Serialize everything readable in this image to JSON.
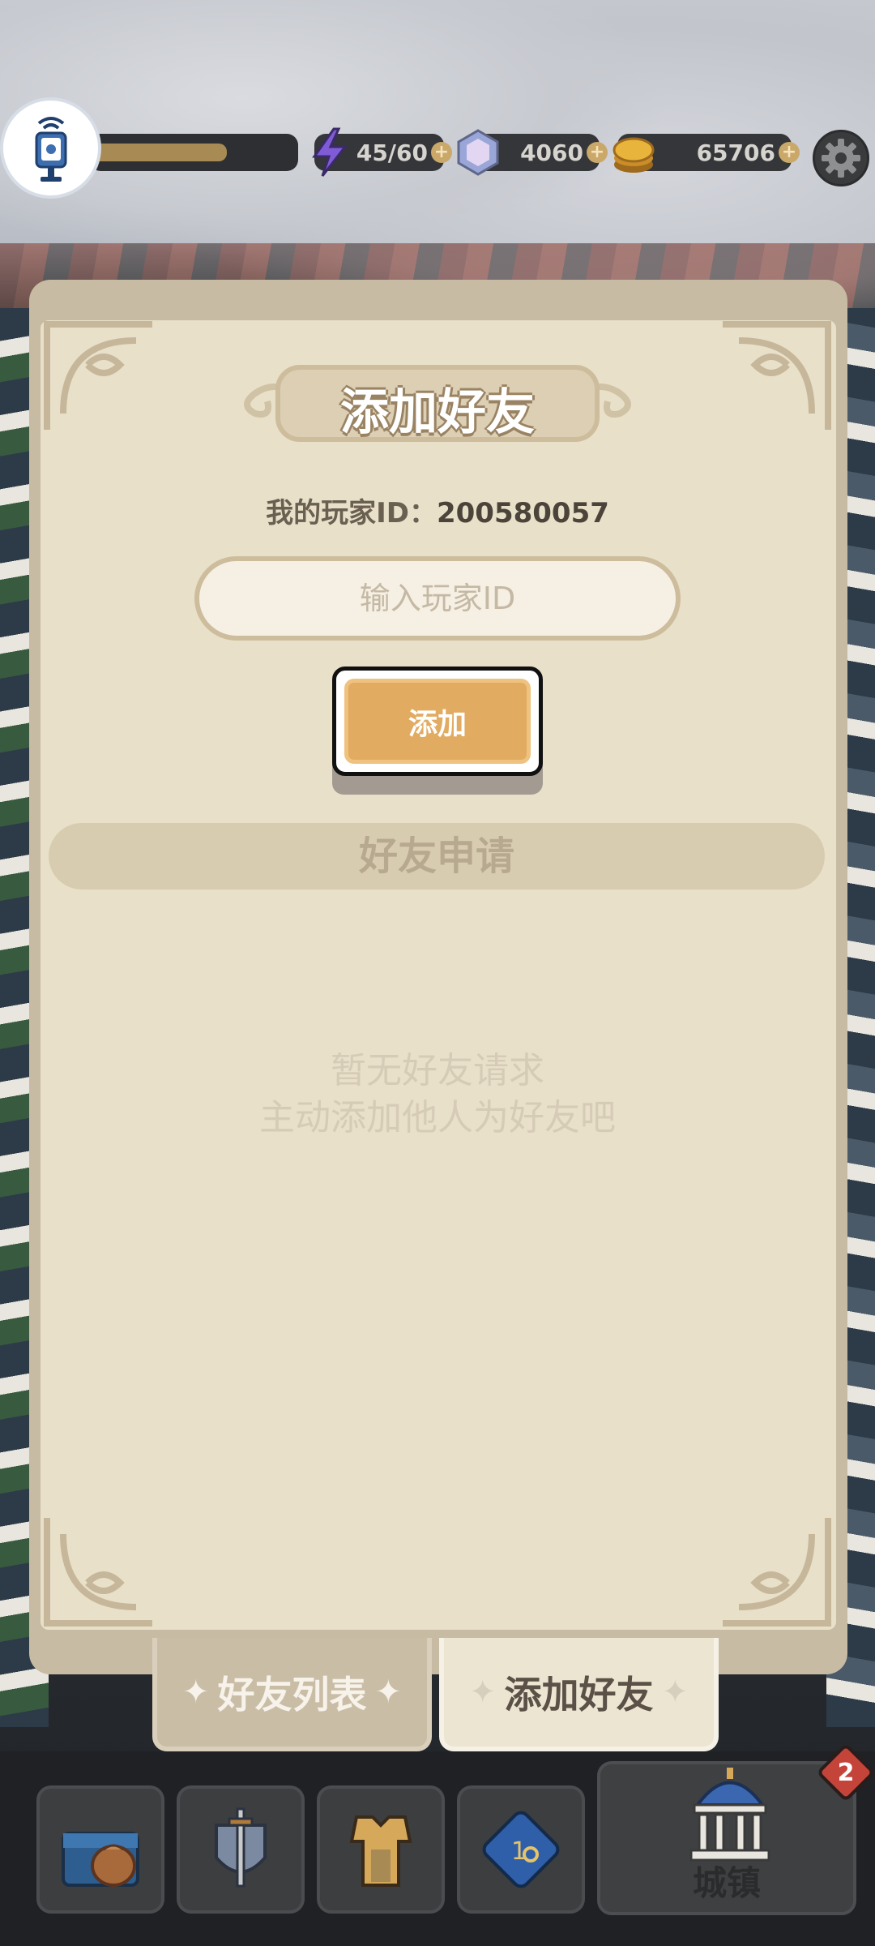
{
  "topbar": {
    "energy": "45/60",
    "gems": "4060",
    "coins": "65706",
    "xp_progress": 0.66
  },
  "panel": {
    "title": "添加好友",
    "my_id_label": "我的玩家ID：",
    "my_id_value": "200580057",
    "id_input_placeholder": "输入玩家ID",
    "add_button_label": "添加",
    "requests_header": "好友申请",
    "empty_line1": "暂无好友请求",
    "empty_line2": "主动添加他人为好友吧"
  },
  "tabs": {
    "friends_list": "好友列表",
    "add_friend": "添加好友"
  },
  "bottom_nav": {
    "town_label": "城镇",
    "town_badge": "2"
  },
  "colors": {
    "panel_bg": "#e8e0c8",
    "button_orange": "#e2ab62",
    "badge_red": "#c4443a"
  }
}
